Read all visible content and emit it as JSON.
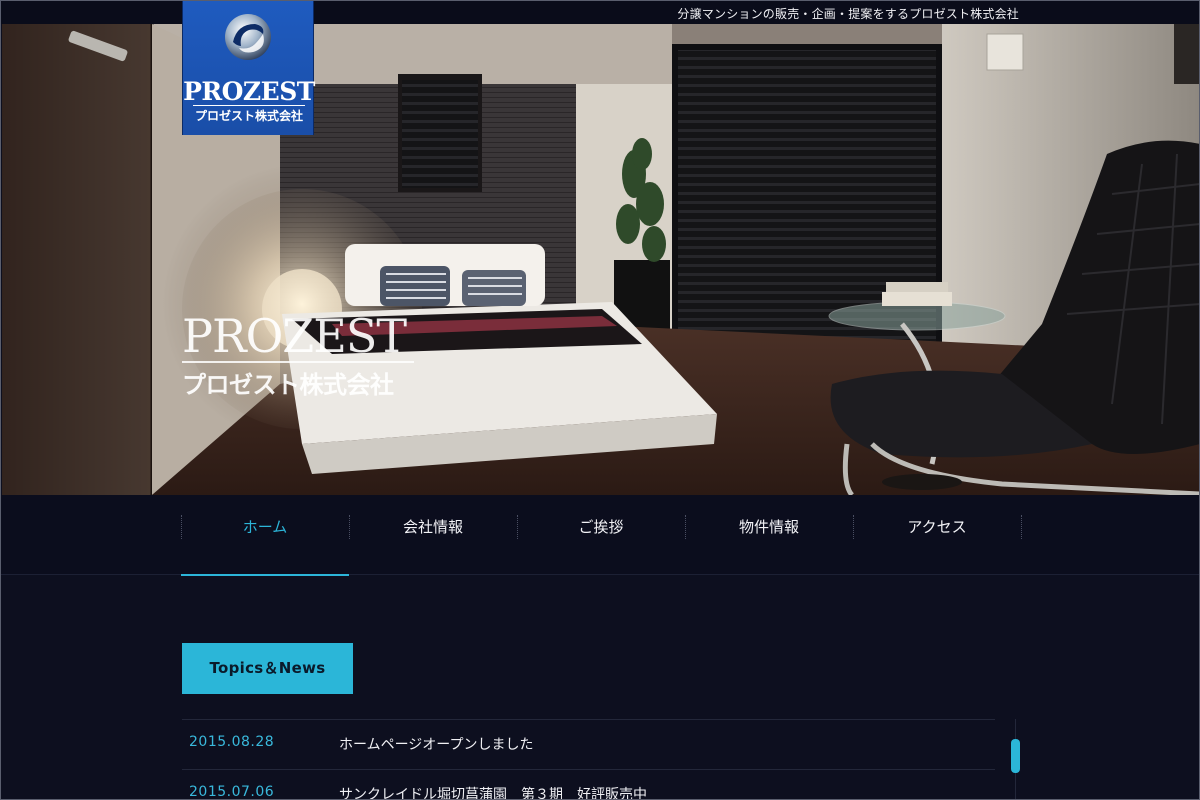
{
  "header": {
    "tagline": "分譲マンションの販売・企画・提案をするプロゼスト株式会社"
  },
  "logo": {
    "name": "PROZEST",
    "sub": "プロゼスト株式会社",
    "color": "#1f5bbf"
  },
  "hero": {
    "brand_name": "PROZEST",
    "brand_sub": "プロゼスト株式会社"
  },
  "nav": {
    "items": [
      {
        "label": "ホーム",
        "active": true
      },
      {
        "label": "会社情報",
        "active": false
      },
      {
        "label": "ご挨拶",
        "active": false
      },
      {
        "label": "物件情報",
        "active": false
      },
      {
        "label": "アクセス",
        "active": false
      }
    ],
    "accent": "#2cb5d9"
  },
  "topics": {
    "button_label": "Topics＆News",
    "items": [
      {
        "date": "2015.08.28",
        "title": "ホームページオープンしました"
      },
      {
        "date": "2015.07.06",
        "title": "サンクレイドル堀切菖蒲園　第３期　好評販売中"
      }
    ]
  }
}
